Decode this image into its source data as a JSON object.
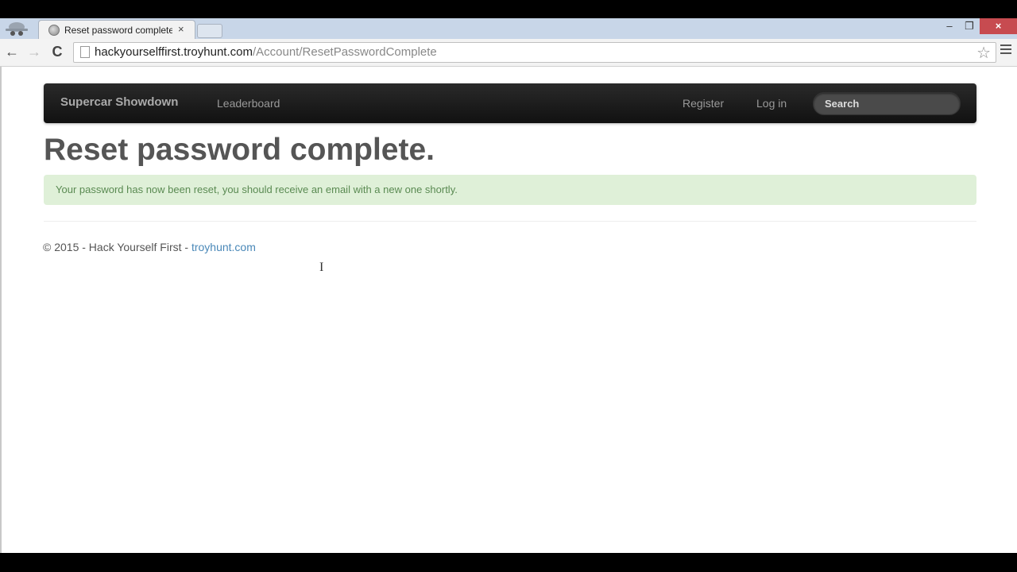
{
  "browser": {
    "tab_title": "Reset password complete",
    "tab_close": "×",
    "url_host": "hackyourselffirst.troyhunt.com",
    "url_path": "/Account/ResetPasswordComplete",
    "icons": {
      "back": "←",
      "forward": "→",
      "reload": "C",
      "star": "☆",
      "minimize": "–",
      "maximize": "❐",
      "close": "×"
    }
  },
  "navbar": {
    "brand": "Supercar Showdown",
    "links": [
      "Leaderboard",
      "Register",
      "Log in"
    ],
    "search_placeholder": "Search"
  },
  "main": {
    "title": "Reset password complete.",
    "alert": "Your password has now been reset, you should receive an email with a new one shortly."
  },
  "footer": {
    "text": "© 2015 - Hack Yourself First - ",
    "link": "troyhunt.com"
  },
  "colors": {
    "alert_bg": "#dff0d8",
    "alert_text": "#5a8a52",
    "link": "#4a88b8",
    "close_button": "#c74b50"
  }
}
